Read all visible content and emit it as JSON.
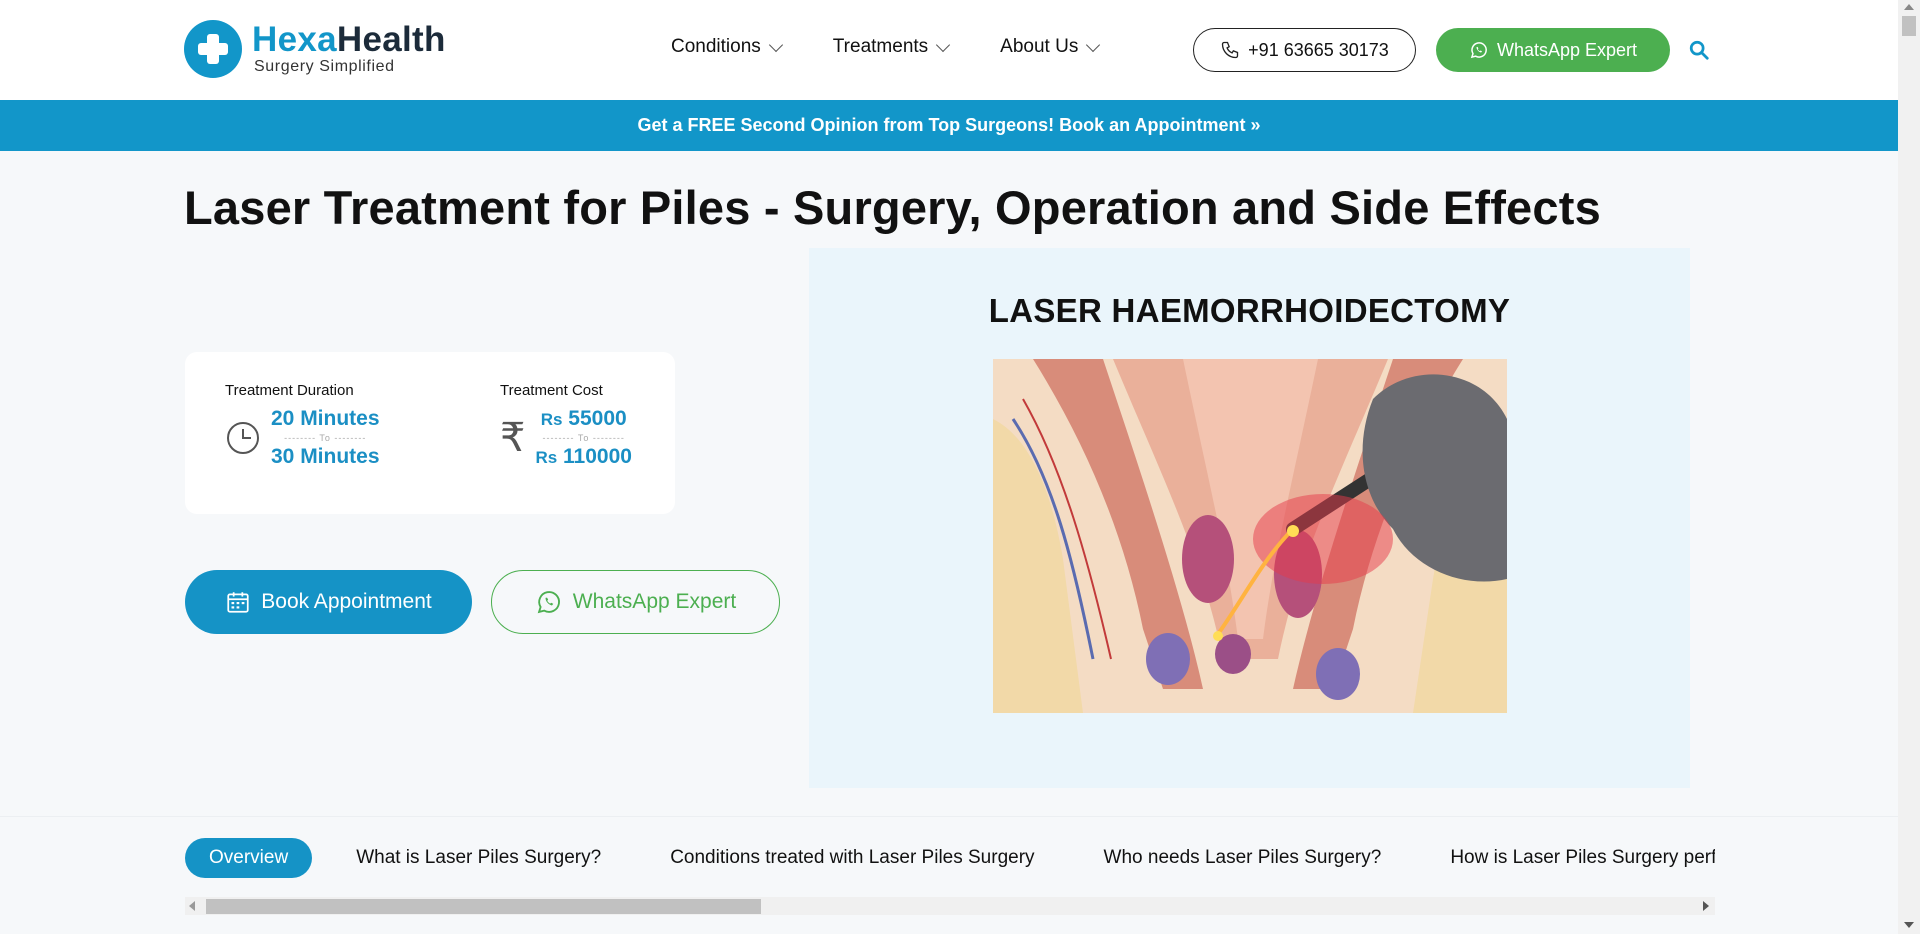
{
  "header": {
    "brand_part1": "Hexa",
    "brand_part2": "Health",
    "tagline": "Surgery Simplified",
    "nav": [
      "Conditions",
      "Treatments",
      "About Us"
    ],
    "phone": "+91 63665 30173",
    "whatsapp_label": "WhatsApp Expert"
  },
  "banner": {
    "text": "Get a FREE Second Opinion from Top Surgeons! Book an Appointment »"
  },
  "main": {
    "title": "Laser Treatment for Piles - Surgery, Operation and Side Effects",
    "duration": {
      "label": "Treatment Duration",
      "min": "20 Minutes",
      "to": "-------- To --------",
      "max": "30 Minutes"
    },
    "cost": {
      "label": "Treatment Cost",
      "currency_symbol": "₹",
      "prefix": "Rs",
      "min": "55000",
      "to": "-------- To --------",
      "max": "110000"
    },
    "book_label": "Book Appointment",
    "whatsapp_label": "WhatsApp Expert",
    "image_title": "LASER HAEMORRHOIDECTOMY"
  },
  "tabs": [
    "Overview",
    "What is Laser Piles Surgery?",
    "Conditions treated with Laser Piles Surgery",
    "Who needs Laser Piles Surgery?",
    "How is Laser Piles Surgery performed?"
  ],
  "colors": {
    "brand_blue": "#1296c9",
    "whatsapp_green": "#4caf50",
    "value_blue": "#1b8fc4"
  },
  "icons": [
    "phone-icon",
    "whatsapp-icon",
    "search-icon",
    "clock-icon",
    "rupee-icon",
    "calendar-icon"
  ]
}
